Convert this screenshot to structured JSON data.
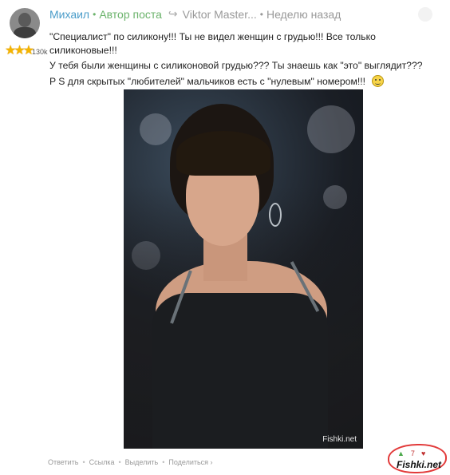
{
  "comment": {
    "author": "Михаил",
    "separator": "•",
    "author_badge": "Автор поста",
    "reply_arrow": "↪",
    "reply_to": "Viktor Master...",
    "time": "Неделю назад",
    "rating_value": "130k",
    "stars": [
      "★",
      "★",
      "★"
    ],
    "lines": [
      "\"Специалист\" по силикону!!! Ты не видел женщин с грудью!!! Все только силиконовые!!!",
      "У тебя были женщины с силиконовой грудью??? Ты знаешь как \"это\" выглядит???",
      "P S для скрытых \"любителей\" мальчиков есть с \"нулевым\" номером!!!"
    ]
  },
  "image": {
    "watermark": "Fishki.net"
  },
  "actions": {
    "reply": "Ответить",
    "link": "Ссылка",
    "select": "Выделить",
    "share": "Поделиться ›",
    "bullet": "•"
  },
  "votes": {
    "up_icon": "▲",
    "count": "7",
    "down_icon": "♥"
  },
  "logo_text": "Fishki.net",
  "colors": {
    "author": "#4a9cc9",
    "post_author": "#6bb36b",
    "meta": "#999999",
    "badge_circle": "#e23a3a"
  }
}
